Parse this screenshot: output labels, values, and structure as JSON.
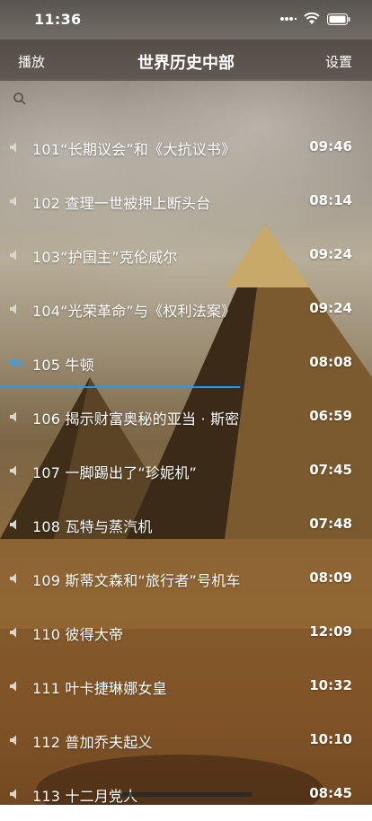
{
  "status_bar": {
    "time": "11:36"
  },
  "nav": {
    "left": "播放",
    "title": "世界历史中部",
    "right": "设置"
  },
  "search": {
    "placeholder": ""
  },
  "episodes": [
    {
      "title": "101“长期议会”和《大抗议书》",
      "duration": "09:46",
      "playing": false
    },
    {
      "title": "102 查理一世被押上断头台",
      "duration": "08:14",
      "playing": false
    },
    {
      "title": "103“护国主”克伦威尔",
      "duration": "09:24",
      "playing": false
    },
    {
      "title": "104“光荣革命”与《权利法案》",
      "duration": "09:24",
      "playing": false
    },
    {
      "title": "105 牛顿",
      "duration": "08:08",
      "playing": true
    },
    {
      "title": "106 揭示财富奥秘的亚当 · 斯密",
      "duration": "06:59",
      "playing": false
    },
    {
      "title": "107 一脚踢出了“珍妮机”",
      "duration": "07:45",
      "playing": false
    },
    {
      "title": "108 瓦特与蒸汽机",
      "duration": "07:48",
      "playing": false
    },
    {
      "title": "109 斯蒂文森和“旅行者”号机车",
      "duration": "08:09",
      "playing": false
    },
    {
      "title": "110 彼得大帝",
      "duration": "12:09",
      "playing": false
    },
    {
      "title": "111 叶卡捷琳娜女皇",
      "duration": "10:32",
      "playing": false
    },
    {
      "title": "112 普加乔夫起义",
      "duration": "10:10",
      "playing": false
    },
    {
      "title": "113 十二月党人",
      "duration": "08:45",
      "playing": false
    }
  ],
  "playback": {
    "progress_fraction": 0.645
  },
  "colors": {
    "accent": "#1e9bff",
    "speaker_idle": "#d9d6d0",
    "speaker_active": "#2ea0ff"
  }
}
